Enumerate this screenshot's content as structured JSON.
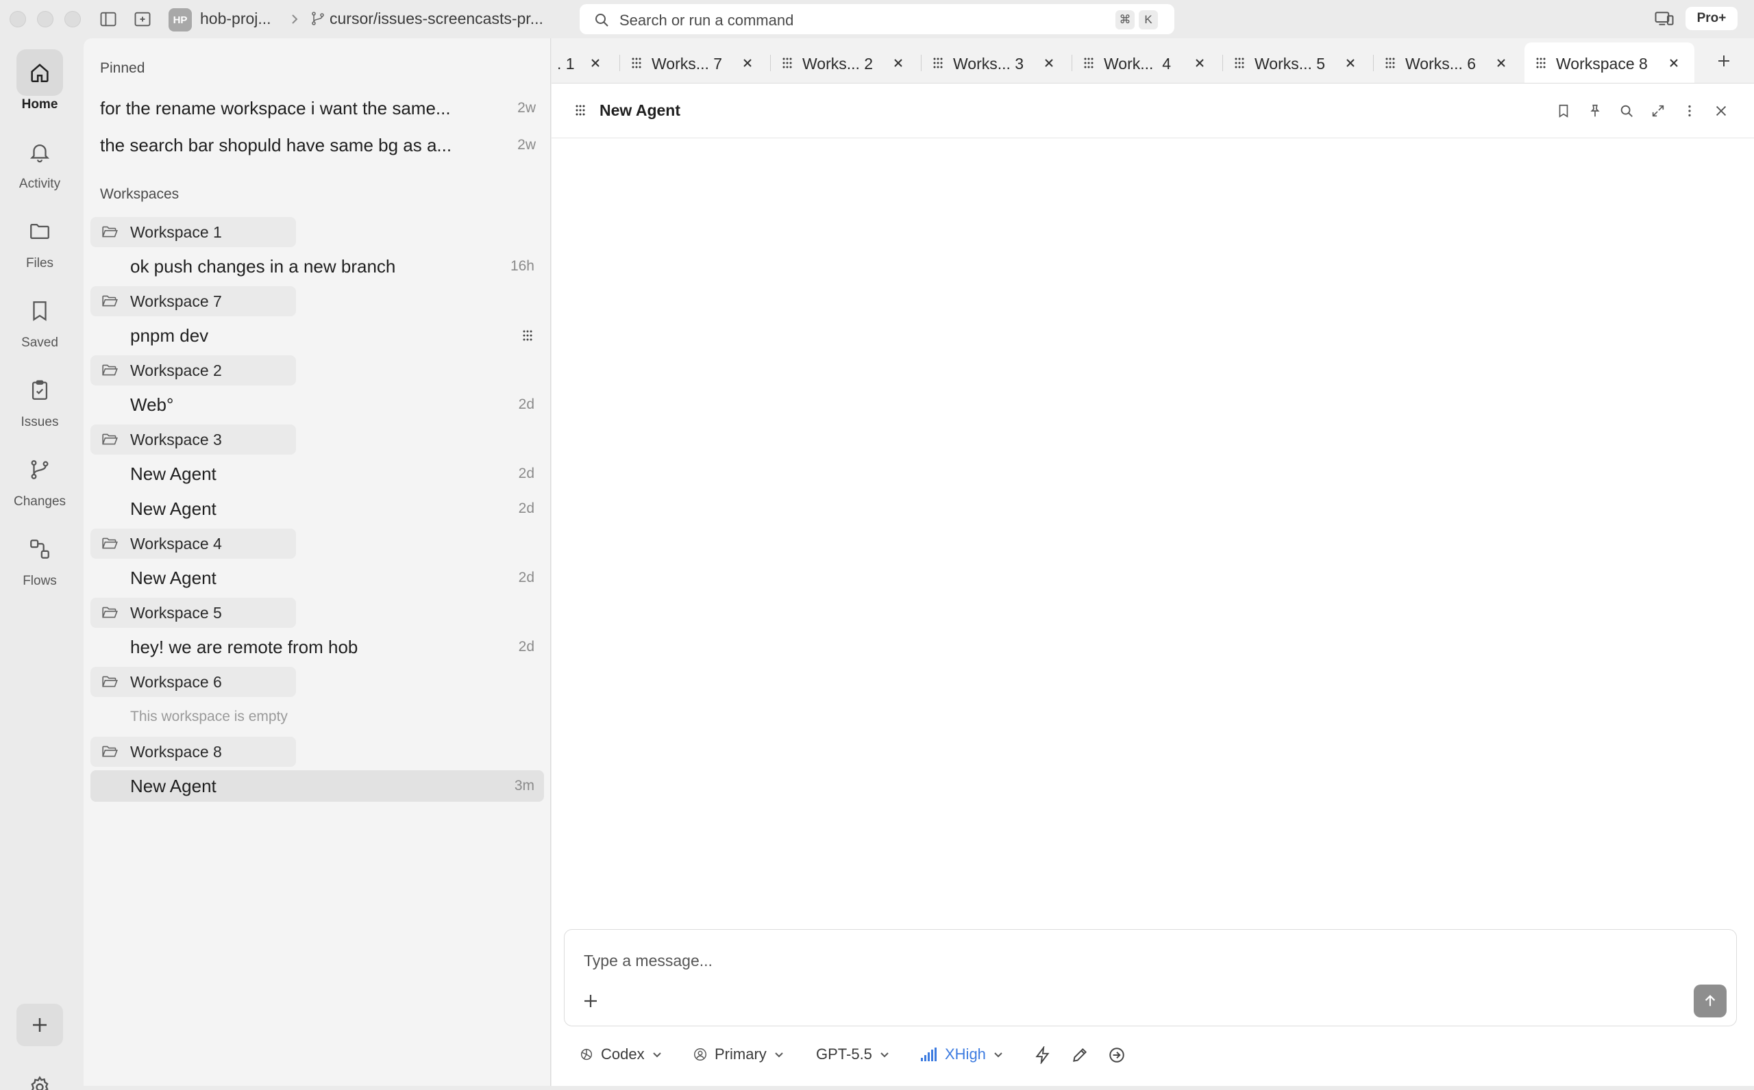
{
  "titlebar": {
    "project_initials": "HP",
    "project_name": "hob-proj...",
    "branch": "cursor/issues-screencasts-pr...",
    "search_placeholder": "Search or run a command",
    "shortcut_cmd": "⌘",
    "shortcut_key": "K",
    "plan_badge": "Pro+"
  },
  "rail": {
    "items": [
      {
        "label": "Home",
        "icon": "home-icon"
      },
      {
        "label": "Activity",
        "icon": "bell-icon"
      },
      {
        "label": "Files",
        "icon": "folder-icon"
      },
      {
        "label": "Saved",
        "icon": "bookmark-icon"
      },
      {
        "label": "Issues",
        "icon": "clipboard-check-icon"
      },
      {
        "label": "Changes",
        "icon": "git-branch-icon"
      },
      {
        "label": "Flows",
        "icon": "flows-icon"
      }
    ]
  },
  "sidebar": {
    "pinned_title": "Pinned",
    "pinned": [
      {
        "text": "for the rename workspace i want the same...",
        "time": "2w"
      },
      {
        "text": "the search bar shopuld have same bg as a...",
        "time": "2w"
      }
    ],
    "workspaces_title": "Workspaces",
    "workspaces": [
      {
        "name": "Workspace 1",
        "agents": [
          {
            "text": "ok push changes in a new branch",
            "time": "16h"
          }
        ]
      },
      {
        "name": "Workspace 7",
        "agents": [
          {
            "text": "pnpm dev",
            "time": ""
          }
        ]
      },
      {
        "name": "Workspace 2",
        "agents": [
          {
            "text": "Web°",
            "time": "2d"
          }
        ]
      },
      {
        "name": "Workspace 3",
        "agents": [
          {
            "text": "New Agent",
            "time": "2d"
          },
          {
            "text": "New Agent",
            "time": "2d"
          }
        ]
      },
      {
        "name": "Workspace 4",
        "agents": [
          {
            "text": "New Agent",
            "time": "2d"
          }
        ]
      },
      {
        "name": "Workspace 5",
        "agents": [
          {
            "text": "hey! we are remote from hob",
            "time": "2d"
          }
        ]
      },
      {
        "name": "Workspace 6",
        "empty_note": "This workspace is empty"
      },
      {
        "name": "Workspace 8",
        "agents": [
          {
            "text": "New Agent",
            "time": "3m"
          }
        ]
      }
    ]
  },
  "tabs": [
    {
      "label": ". 1"
    },
    {
      "label": "Works... 7"
    },
    {
      "label": "Works... 2"
    },
    {
      "label": "Works... 3"
    },
    {
      "label": "Work...  4"
    },
    {
      "label": "Works... 5"
    },
    {
      "label": "Works... 6"
    },
    {
      "label": "Workspace 8",
      "active": true
    }
  ],
  "agent": {
    "title": "New Agent",
    "composer_placeholder": "Type a message..."
  },
  "toolbar": {
    "engine": "Codex",
    "profile": "Primary",
    "model": "GPT-5.5",
    "effort": "XHigh"
  },
  "colors": {
    "accent": "#3c7be0",
    "send_button": "#8e8e8e"
  }
}
